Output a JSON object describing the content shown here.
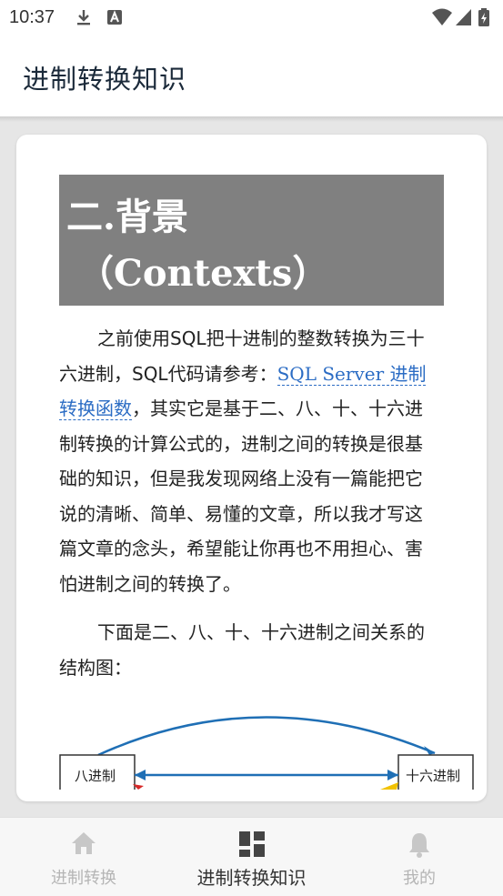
{
  "status_bar": {
    "time": "10:37",
    "left_icons": [
      "download-icon",
      "a-square-icon"
    ],
    "right_icons": [
      "wifi-icon",
      "cell-signal-icon",
      "battery-charging-icon"
    ]
  },
  "app_bar": {
    "title": "进制转换知识"
  },
  "article": {
    "heading_line1": "二.背景",
    "heading_line2": "（Contexts）",
    "para1_text_a": "之前使用SQL把十进制的整数转换为三十六进制，SQL代码请参考：",
    "para1_link": "SQL Server 进制转换函数",
    "para1_text_b": "，其实它是基于二、八、十、十六进制转换的计算公式的，进制之间的转换是很基础的知识，但是我发现网络上没有一篇能把它说的清晰、简单、易懂的文章，所以我才写这篇文章的念头，希望能让你再也不用担心、害怕进制之间的转换了。",
    "para2_text": "下面是二、八、十、十六进制之间关系的结构图：",
    "diagram": {
      "left_box": "八进制",
      "right_box": "十六进制"
    }
  },
  "bottom_nav": {
    "items": [
      {
        "label": "进制转换",
        "icon": "home-icon",
        "active": false
      },
      {
        "label": "进制转换知识",
        "icon": "dashboard-icon",
        "active": true
      },
      {
        "label": "我的",
        "icon": "bell-icon",
        "active": false
      }
    ]
  },
  "colors": {
    "heading_bg": "#808080",
    "link": "#2b6cc4",
    "content_bg": "#e6e6e6",
    "nav_inactive": "#b5b5b5"
  }
}
